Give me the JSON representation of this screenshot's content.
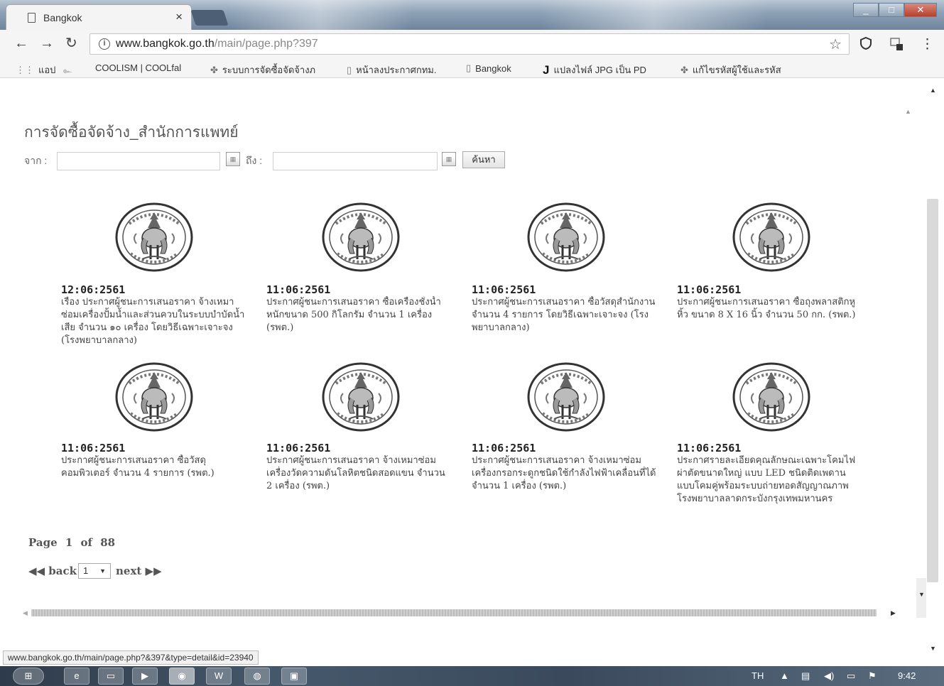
{
  "browser": {
    "tab_title": "Bangkok",
    "tab_close": "×",
    "url_host": "www.bangkok.go.th",
    "url_path": "/main/page.php?397",
    "nav": {
      "back": "←",
      "forward": "→",
      "reload": "↻"
    },
    "bookmarks": [
      {
        "icon": "apps-icon",
        "label": "แอป"
      },
      {
        "icon": "bookmark-icon",
        "label": "COOLISM | COOLfal"
      },
      {
        "icon": "bookmark-icon",
        "label": "ระบบการจัดซื้อจัดจ้างภ"
      },
      {
        "icon": "page-icon",
        "label": "หน้าลงประกาศกทม."
      },
      {
        "icon": "page-icon",
        "label": "Bangkok"
      },
      {
        "icon": "bookmark-icon",
        "label": "แปลงไฟล์ JPG เป็น PD"
      },
      {
        "icon": "bookmark-icon",
        "label": "แก้ไขรหัสผู้ใช้และรหัส"
      }
    ]
  },
  "page": {
    "title": "การจัดซื้อจัดจ้าง_สำนักการแพทย์",
    "from_label": "จาก :",
    "to_label": "ถึง :",
    "search_label": "ค้นหา",
    "items": [
      {
        "date": "12:06:2561",
        "text": "เรื่อง ประกาศผู้ชนะการเสนอราคา จ้างเหมาซ่อมเครื่องปั้มน้ำและส่วนควบในระบบบำบัดน้ำเสีย จำนวน ๑๐ เครื่อง โดยวิธีเฉพาะเจาะจง (โรงพยาบาลกลาง)"
      },
      {
        "date": "11:06:2561",
        "text": "ประกาศผู้ชนะการเสนอราคา ซื้อเครื่องชั่งน้ำหนักขนาด 500 กิโลกรัม จำนวน 1 เครื่อง (รพต.)"
      },
      {
        "date": "11:06:2561",
        "text": "ประกาศผู้ชนะการเสนอราคา ซื้อวัสดุสำนักงาน จำนวน 4 รายการ โดยวิธีเฉพาะเจาะจง (โรงพยาบาลกลาง)"
      },
      {
        "date": "11:06:2561",
        "text": "ประกาศผู้ชนะการเสนอราคา ซื้อถุงพลาสติกหูหิ้ว ขนาด 8 X 16 นิ้ว จำนวน 50 กก. (รพต.)"
      },
      {
        "date": "11:06:2561",
        "text": "ประกาศผู้ชนะการเสนอราคา ซื้อวัสดุคอมพิวเตอร์ จำนวน 4 รายการ (รพต.)"
      },
      {
        "date": "11:06:2561",
        "text": "ประกาศผู้ชนะการเสนอราคา จ้างเหมาซ่อมเครื่องวัดความดันโลหิตชนิดสอดแขน จำนวน 2 เครื่อง (รพต.)"
      },
      {
        "date": "11:06:2561",
        "text": "ประกาศผู้ชนะการเสนอราคา จ้างเหมาซ่อมเครื่องกรอกระดูกชนิดใช้กำลังไฟฟ้าเคลื่อนที่ได้ จำนวน 1 เครื่อง (รพต.)"
      },
      {
        "date": "11:06:2561",
        "text": "ประกาศรายละเอียดคุณลักษณะเฉพาะโคมไฟผ่าตัดขนาดใหญ่ แบบ LED ชนิดติดเพดานแบบโคมคู่พร้อมระบบถ่ายทอดสัญญาณภาพ โรงพยาบาลลาดกระบังกรุงเทพมหานคร"
      }
    ],
    "pager": {
      "page_word": "Page",
      "current": "1",
      "of_word": "of",
      "total": "88"
    },
    "back_label": "◀◀ back",
    "next_label": "next ▶▶",
    "select_value": "1",
    "status_url": "www.bangkok.go.th/main/page.php?&397&type=detail&id=23940"
  },
  "taskbar": {
    "lang": "TH",
    "clock": "9:42"
  },
  "colors": {
    "text": "#444444",
    "title": "#555555",
    "accent": "#4d5f74"
  }
}
